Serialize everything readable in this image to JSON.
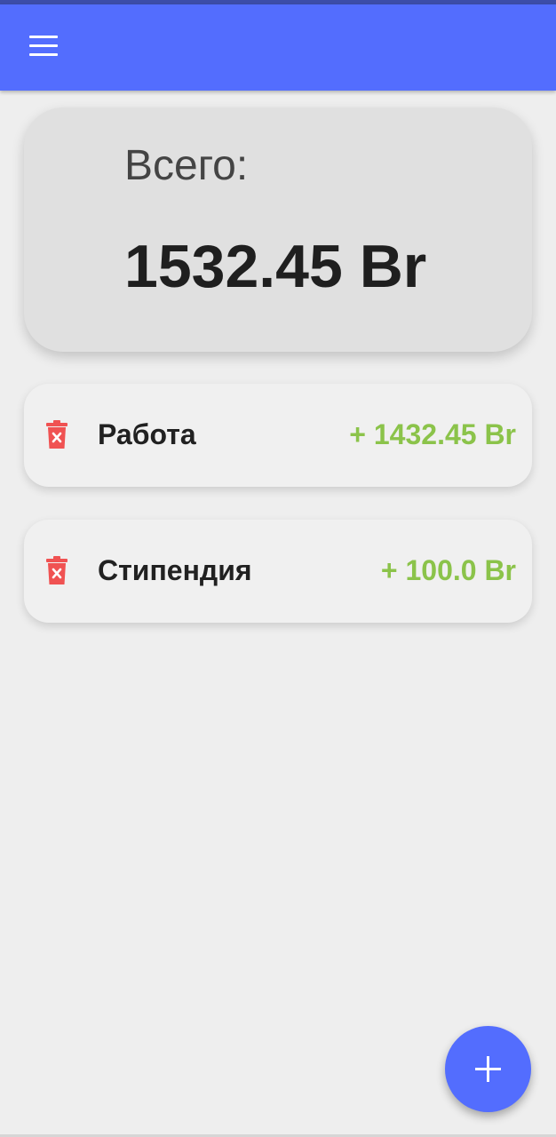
{
  "colors": {
    "primary": "#536dfe",
    "income_green": "#8bc34a",
    "delete_red": "#f05252"
  },
  "appbar": {
    "menu_icon": "hamburger-menu-icon"
  },
  "summary": {
    "label": "Всего:",
    "total": "1532.45 Br"
  },
  "entries": [
    {
      "name": "Работа",
      "amount": "+ 1432.45 Br",
      "icon": "delete-trash-icon"
    },
    {
      "name": "Стипендия",
      "amount": "+ 100.0 Br",
      "icon": "delete-trash-icon"
    }
  ],
  "fab": {
    "icon": "plus-icon"
  }
}
